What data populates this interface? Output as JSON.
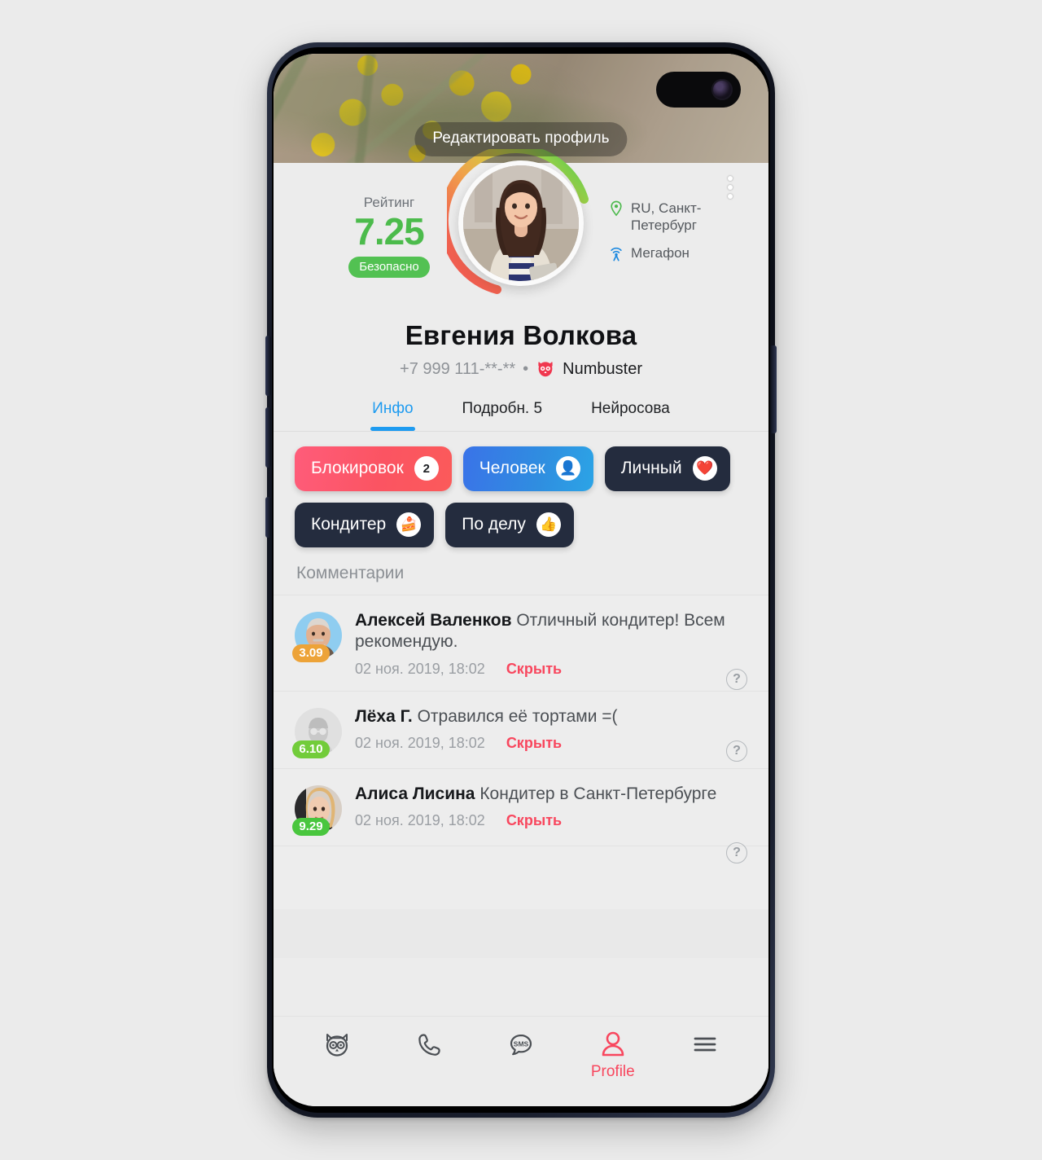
{
  "cover": {
    "edit_button_label": "Редактировать профиль",
    "menu_icon": "kebab-menu-icon"
  },
  "hero": {
    "rating_label": "Рейтинг",
    "rating_value": "7.25",
    "rating_badge": "Безопасно",
    "rating_color": "#4cbb4c",
    "location_icon": "location-pin-icon",
    "location": "RU, Санкт-Петербург",
    "operator_icon": "cell-signal-icon",
    "operator": "Мегафон"
  },
  "profile": {
    "name": "Евгения Волкова",
    "phone": "+7 999 111-**-**",
    "separator": "•",
    "app_name": "Numbuster"
  },
  "tabs": [
    {
      "label": "Инфо",
      "active": true
    },
    {
      "label": "Подробн. 5",
      "active": false
    },
    {
      "label": "Нейросова",
      "active": false
    }
  ],
  "chips": [
    {
      "label": "Блокировок",
      "badge": "2",
      "style": "red",
      "badge_kind": "count"
    },
    {
      "label": "Человек",
      "badge": "👤",
      "style": "blue",
      "badge_kind": "emoji"
    },
    {
      "label": "Личный",
      "badge": "❤️",
      "style": "dark",
      "badge_kind": "emoji"
    },
    {
      "label": "Кондитер",
      "badge": "🍰",
      "style": "dark",
      "badge_kind": "emoji"
    },
    {
      "label": "По делу",
      "badge": "👍",
      "style": "dark",
      "badge_kind": "emoji"
    }
  ],
  "comments": {
    "title": "Комментарии",
    "items": [
      {
        "author": "Алексей Валенков",
        "text": "Отличный кондитер! Всем рекомендую.",
        "date": "02 ноя. 2019, 18:02",
        "hide_label": "Скрыть",
        "score": "3.09",
        "score_color": "#eda338",
        "avatar_kind": "photo-man"
      },
      {
        "author": "Лёха Г.",
        "text": "Отравился её тортами =(",
        "date": "02 ноя. 2019, 18:02",
        "hide_label": "Скрыть",
        "score": "6.10",
        "score_color": "#72cc3a",
        "avatar_kind": "placeholder"
      },
      {
        "author": "Алиса Лисина",
        "text": "Кондитер в Санкт-Петербурге",
        "date": "02 ноя. 2019, 18:02",
        "hide_label": "Скрыть",
        "score": "9.29",
        "score_color": "#49c63e",
        "avatar_kind": "photo-woman"
      }
    ],
    "help_glyph": "?"
  },
  "bottom_nav": {
    "items": [
      {
        "icon": "owl-icon",
        "label": ""
      },
      {
        "icon": "phone-icon",
        "label": ""
      },
      {
        "icon": "sms-bubble-icon",
        "label": ""
      },
      {
        "icon": "person-icon",
        "label": "Profile",
        "active": true
      },
      {
        "icon": "hamburger-menu-icon",
        "label": ""
      }
    ],
    "active_color": "#f8475e"
  }
}
